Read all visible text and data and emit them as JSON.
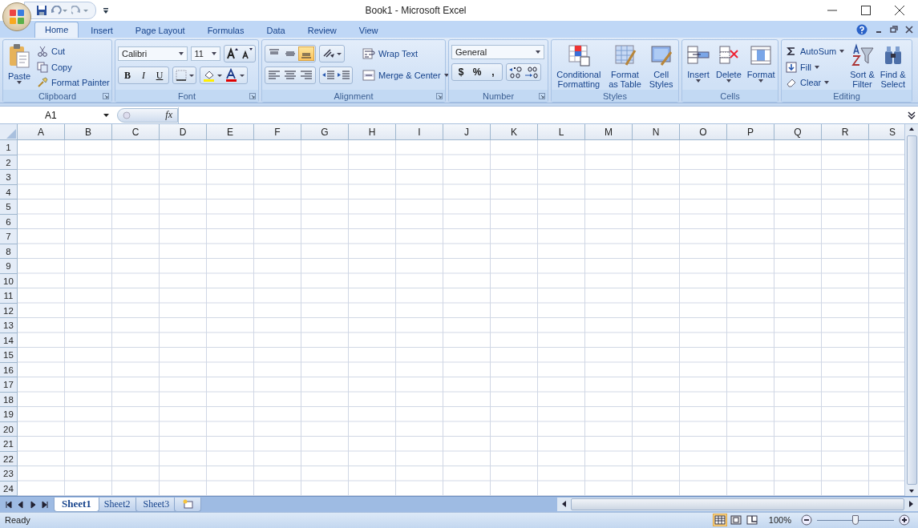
{
  "window": {
    "title": "Book1 - Microsoft Excel"
  },
  "ribbon_tabs": [
    {
      "label": "Home",
      "selected": true
    },
    {
      "label": "Insert",
      "selected": false
    },
    {
      "label": "Page Layout",
      "selected": false
    },
    {
      "label": "Formulas",
      "selected": false
    },
    {
      "label": "Data",
      "selected": false
    },
    {
      "label": "Review",
      "selected": false
    },
    {
      "label": "View",
      "selected": false
    }
  ],
  "clipboard": {
    "label": "Clipboard",
    "paste": "Paste",
    "items": [
      "Cut",
      "Copy",
      "Format Painter"
    ]
  },
  "font": {
    "label": "Font",
    "family": "Calibri",
    "size": "11",
    "styles": [
      "B",
      "I",
      "U"
    ]
  },
  "alignment": {
    "label": "Alignment",
    "vertical": [
      {
        "kind": "top",
        "selected": false
      },
      {
        "kind": "middle",
        "selected": false
      },
      {
        "kind": "bottom",
        "selected": true
      }
    ],
    "wrap": "Wrap Text",
    "merge": "Merge & Center"
  },
  "number": {
    "label": "Number",
    "format": "General",
    "symbols": [
      "$",
      "%",
      ","
    ]
  },
  "styles": {
    "label": "Styles",
    "items": [
      {
        "lines": [
          "Conditional",
          "Formatting"
        ]
      },
      {
        "lines": [
          "Format",
          "as Table"
        ]
      },
      {
        "lines": [
          "Cell",
          "Styles"
        ]
      }
    ]
  },
  "cells": {
    "label": "Cells",
    "items": [
      "Insert",
      "Delete",
      "Format"
    ]
  },
  "editing": {
    "label": "Editing",
    "small": [
      "AutoSum",
      "Fill",
      "Clear"
    ],
    "large": [
      {
        "lines": [
          "Sort &",
          "Filter"
        ]
      },
      {
        "lines": [
          "Find &",
          "Select"
        ]
      }
    ]
  },
  "formula_bar": {
    "name_box": "A1",
    "fx": "fx"
  },
  "sheet": {
    "columns": [
      "A",
      "B",
      "C",
      "D",
      "E",
      "F",
      "G",
      "H",
      "I",
      "J",
      "K",
      "L",
      "M",
      "N",
      "O",
      "P",
      "Q",
      "R",
      "S"
    ],
    "rows": [
      "1",
      "2",
      "3",
      "4",
      "5",
      "6",
      "7",
      "8",
      "9",
      "10",
      "11",
      "12",
      "13",
      "14",
      "15",
      "16",
      "17",
      "18",
      "19",
      "20",
      "21",
      "22",
      "23",
      "24"
    ]
  },
  "sheet_tabs": [
    {
      "label": "Sheet1",
      "selected": true
    },
    {
      "label": "Sheet2",
      "selected": false
    },
    {
      "label": "Sheet3",
      "selected": false
    }
  ],
  "status_bar": {
    "status": "Ready",
    "views": [
      {
        "kind": "normal",
        "selected": true
      },
      {
        "kind": "page_layout",
        "selected": false
      },
      {
        "kind": "page_break",
        "selected": false
      }
    ],
    "zoom": "100%",
    "zoom_slider": {
      "level": 0.5
    }
  }
}
